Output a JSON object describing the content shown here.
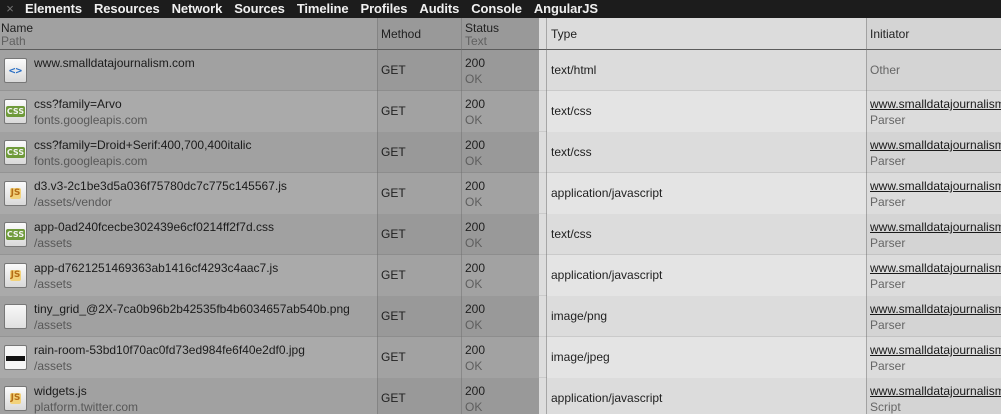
{
  "tabs": [
    "Elements",
    "Resources",
    "Network",
    "Sources",
    "Timeline",
    "Profiles",
    "Audits",
    "Console",
    "AngularJS"
  ],
  "close_glyph": "×",
  "header": {
    "name": "Name",
    "path": "Path",
    "method": "Method",
    "status": "Status",
    "text": "Text",
    "type": "Type",
    "initiator": "Initiator"
  },
  "rows": [
    {
      "icon": "html-file-icon",
      "name": "www.smalldatajournalism.com",
      "path": "",
      "method": "GET",
      "status": "200",
      "status_text": "OK",
      "type": "text/html",
      "initiator": "",
      "initiator_type": "Other"
    },
    {
      "icon": "css-file-icon",
      "name": "css?family=Arvo",
      "path": "fonts.googleapis.com",
      "method": "GET",
      "status": "200",
      "status_text": "OK",
      "type": "text/css",
      "initiator": "www.smalldatajournalism.com",
      "initiator_type": "Parser"
    },
    {
      "icon": "css-file-icon",
      "name": "css?family=Droid+Serif:400,700,400italic",
      "path": "fonts.googleapis.com",
      "method": "GET",
      "status": "200",
      "status_text": "OK",
      "type": "text/css",
      "initiator": "www.smalldatajournalism.com",
      "initiator_type": "Parser"
    },
    {
      "icon": "js-file-icon",
      "name": "d3.v3-2c1be3d5a036f75780dc7c775c145567.js",
      "path": "/assets/vendor",
      "method": "GET",
      "status": "200",
      "status_text": "OK",
      "type": "application/javascript",
      "initiator": "www.smalldatajournalism.com",
      "initiator_type": "Parser"
    },
    {
      "icon": "css-file-icon",
      "name": "app-0ad240fcecbe302439e6cf0214ff2f7d.css",
      "path": "/assets",
      "method": "GET",
      "status": "200",
      "status_text": "OK",
      "type": "text/css",
      "initiator": "www.smalldatajournalism.com",
      "initiator_type": "Parser"
    },
    {
      "icon": "js-file-icon",
      "name": "app-d7621251469363ab1416cf4293c4aac7.js",
      "path": "/assets",
      "method": "GET",
      "status": "200",
      "status_text": "OK",
      "type": "application/javascript",
      "initiator": "www.smalldatajournalism.com",
      "initiator_type": "Parser"
    },
    {
      "icon": "png-image-icon",
      "name": "tiny_grid_@2X-7ca0b96b2b42535fb4b6034657ab540b.png",
      "path": "/assets",
      "method": "GET",
      "status": "200",
      "status_text": "OK",
      "type": "image/png",
      "initiator": "www.smalldatajournalism.com",
      "initiator_type": "Parser"
    },
    {
      "icon": "jpg-image-icon",
      "name": "rain-room-53bd10f70ac0fd73ed984fe6f40e2df0.jpg",
      "path": "/assets",
      "method": "GET",
      "status": "200",
      "status_text": "OK",
      "type": "image/jpeg",
      "initiator": "www.smalldatajournalism.com",
      "initiator_type": "Parser"
    },
    {
      "icon": "js-file-icon",
      "name": "widgets.js",
      "path": "platform.twitter.com",
      "method": "GET",
      "status": "200",
      "status_text": "OK",
      "type": "application/javascript",
      "initiator": "www.smalldatajournalism.com",
      "initiator_type": "Script"
    }
  ],
  "icon_labels": {
    "html-file-icon": "<>",
    "css-file-icon": "CSS",
    "js-file-icon": "JS"
  },
  "colors": {
    "toolbar": "#1c1c1c",
    "name_column": "#a1a1a1",
    "type_column": "#dcdcdc"
  }
}
